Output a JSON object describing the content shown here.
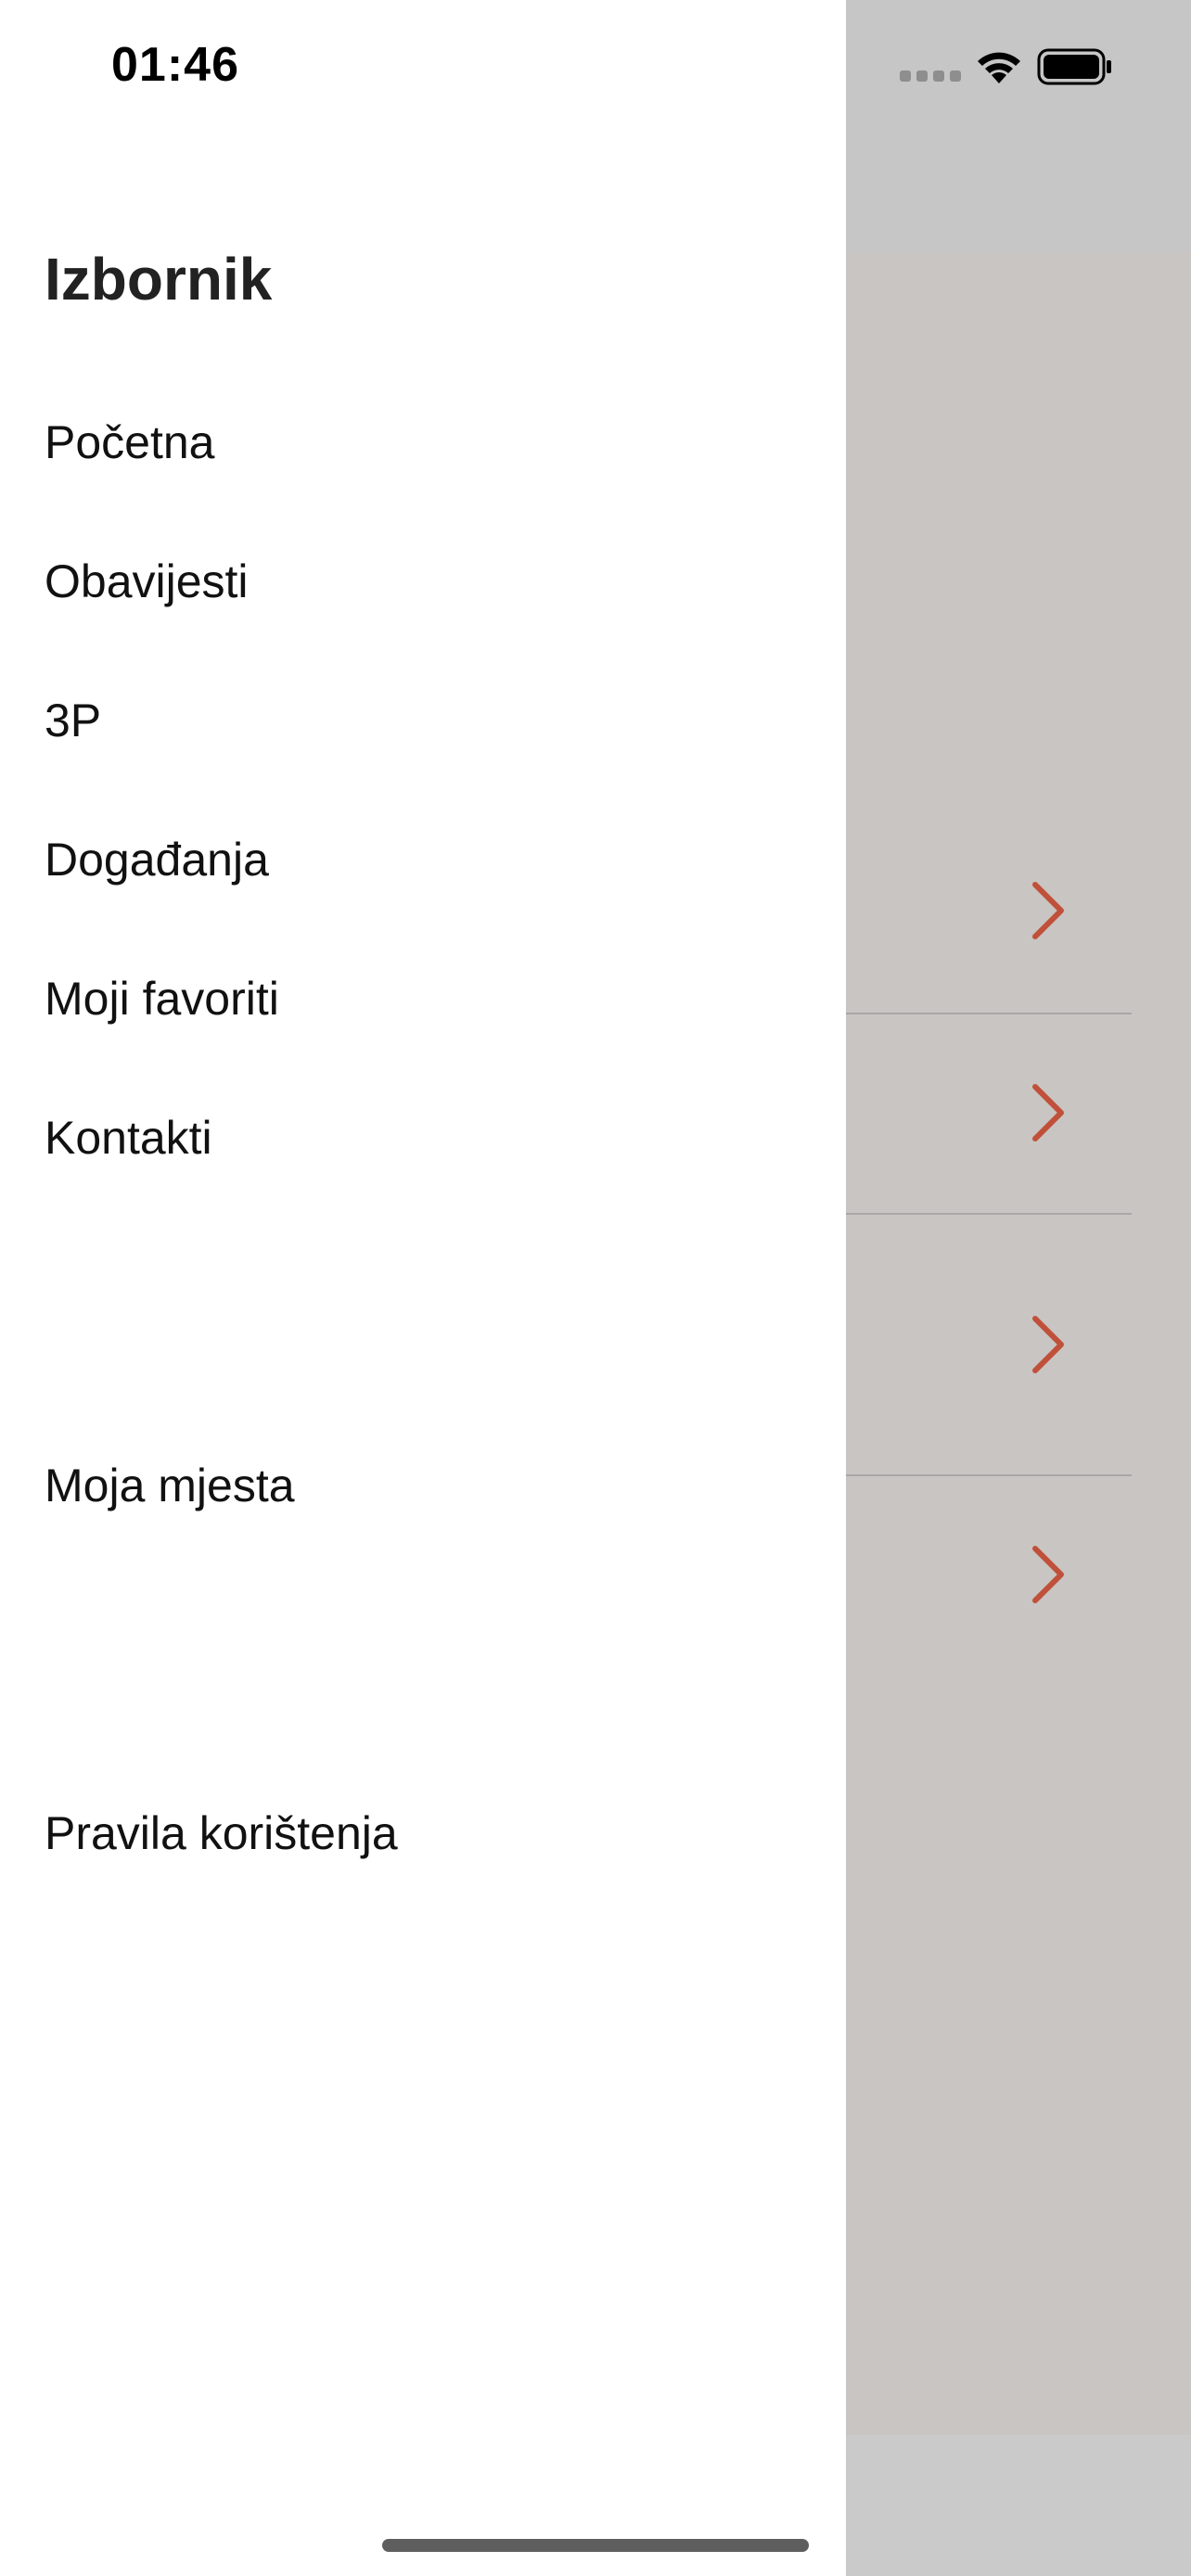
{
  "status_bar": {
    "time": "01:46"
  },
  "drawer": {
    "title": "Izbornik",
    "items": [
      {
        "label": "Početna"
      },
      {
        "label": "Obavijesti"
      },
      {
        "label": "3P"
      },
      {
        "label": "Događanja"
      },
      {
        "label": "Moji favoriti"
      },
      {
        "label": "Kontakti"
      },
      {
        "label": "Moja mjesta"
      },
      {
        "label": "Pravila korištenja"
      }
    ]
  },
  "colors": {
    "accent_chevron": "#c0503a",
    "backdrop": "#c9c5c3"
  },
  "icons": {
    "row_chevron": "chevron-right-icon",
    "wifi": "wifi-icon",
    "battery": "battery-icon",
    "signal": "cellular-signal-icon"
  }
}
